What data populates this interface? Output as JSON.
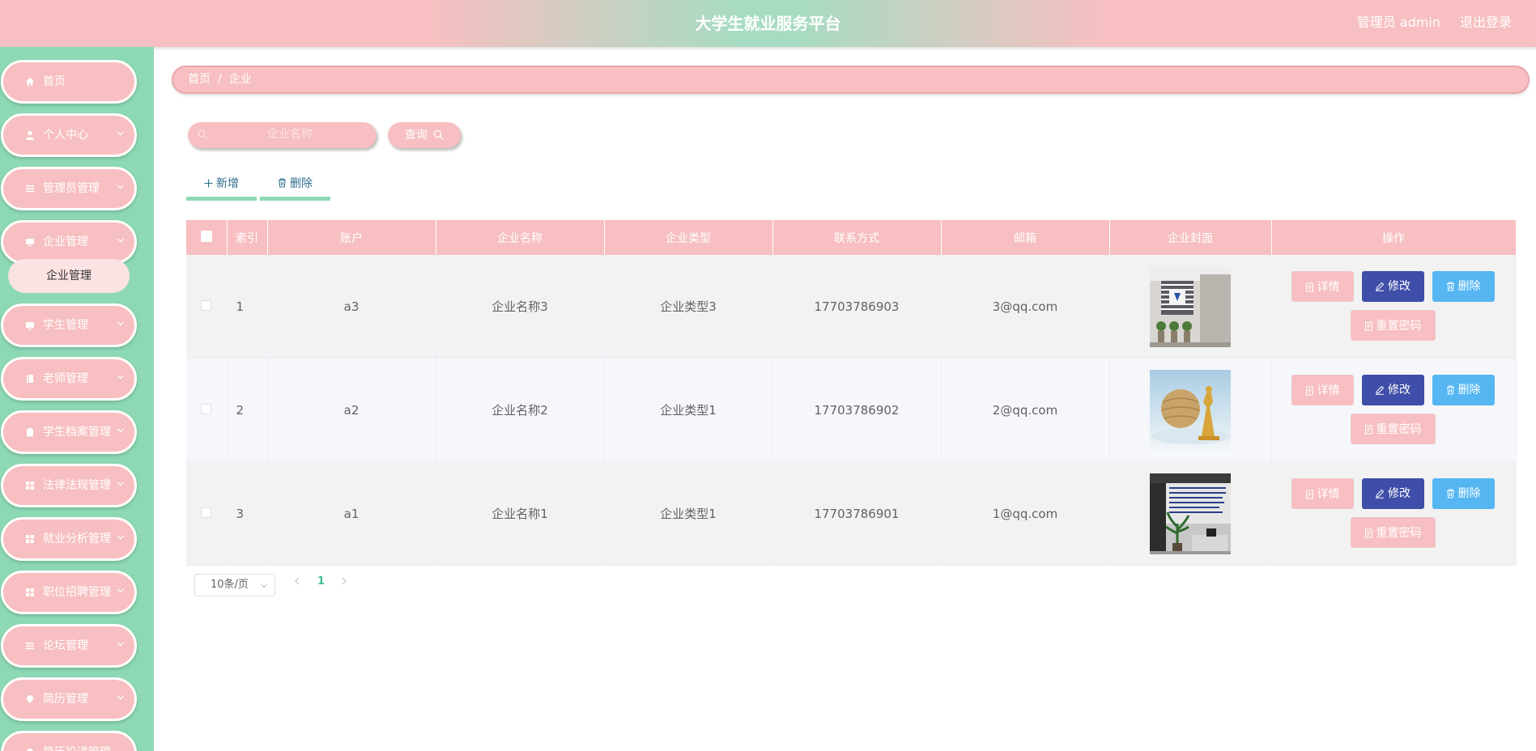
{
  "header": {
    "title": "大学生就业服务平台",
    "user": "管理员 admin",
    "logout": "退出登录"
  },
  "sidebar": {
    "items": [
      {
        "label": "首页",
        "icon": "home-icon"
      },
      {
        "label": "个人中心",
        "icon": "user-icon"
      },
      {
        "label": "管理员管理",
        "icon": "list-icon"
      },
      {
        "label": "企业管理",
        "icon": "monitor-icon"
      },
      {
        "label": "学生管理",
        "icon": "monitor-icon"
      },
      {
        "label": "老师管理",
        "icon": "book-icon"
      },
      {
        "label": "学生档案管理",
        "icon": "clipboard-icon"
      },
      {
        "label": "法律法规管理",
        "icon": "grid-icon"
      },
      {
        "label": "就业分析管理",
        "icon": "grid-icon"
      },
      {
        "label": "职位招聘管理",
        "icon": "grid-icon"
      },
      {
        "label": "论坛管理",
        "icon": "list-icon"
      },
      {
        "label": "简历管理",
        "icon": "pin-icon"
      },
      {
        "label": "简历投递管理",
        "icon": "pin-icon"
      }
    ],
    "submenu": "企业管理"
  },
  "breadcrumb": {
    "home": "首页",
    "separator": "/",
    "current": "企业"
  },
  "search": {
    "placeholder": "企业名称",
    "button": "查询"
  },
  "toolbar": {
    "add_label": "新增",
    "delete_label": "删除"
  },
  "table": {
    "headers": [
      "索引",
      "账户",
      "企业名称",
      "企业类型",
      "联系方式",
      "邮箱",
      "企业封面",
      "操作"
    ],
    "rows": [
      {
        "index": "1",
        "account": "a3",
        "name": "企业名称3",
        "type": "企业类型3",
        "phone": "17703786903",
        "email": "3@qq.com"
      },
      {
        "index": "2",
        "account": "a2",
        "name": "企业名称2",
        "type": "企业类型1",
        "phone": "17703786902",
        "email": "2@qq.com"
      },
      {
        "index": "3",
        "account": "a1",
        "name": "企业名称1",
        "type": "企业类型1",
        "phone": "17703786901",
        "email": "1@qq.com"
      }
    ],
    "ops": {
      "detail": "详情",
      "edit": "修改",
      "remove": "删除",
      "reset": "重置密码"
    }
  },
  "pagination": {
    "size": "10条/页",
    "page": "1"
  },
  "colors": {
    "pink": "#f7bfc1",
    "green": "#8dd9b6",
    "navy": "#3f4ea8",
    "blue": "#55b6f2"
  }
}
